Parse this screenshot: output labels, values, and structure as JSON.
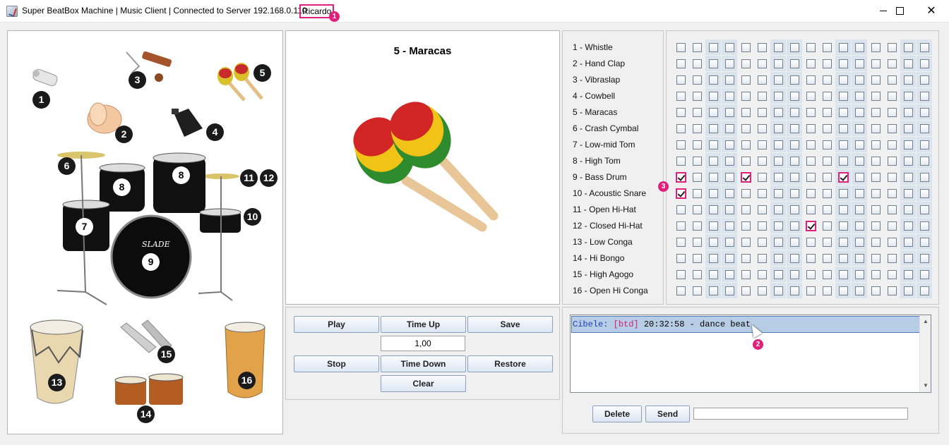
{
  "window": {
    "title": "Super BeatBox Machine | Music Client | Connected to Server 192.168.0.110",
    "user": "Ricardo",
    "controls": {
      "minimize": "",
      "maximize": "",
      "close": "✕"
    }
  },
  "markers": [
    "1",
    "2",
    "3"
  ],
  "instrument_map": {
    "badges": [
      "1",
      "2",
      "3",
      "4",
      "5",
      "6",
      "7",
      "8",
      "8",
      "9",
      "10",
      "11",
      "12",
      "13",
      "14",
      "15",
      "16"
    ],
    "drum_logo": "SLADE"
  },
  "preview": {
    "title": "5 - Maracas"
  },
  "controls": {
    "play": "Play",
    "time_up": "Time Up",
    "save": "Save",
    "tempo": "1,00",
    "stop": "Stop",
    "time_down": "Time Down",
    "restore": "Restore",
    "clear": "Clear"
  },
  "instruments": [
    "1 - Whistle",
    "2 - Hand Clap",
    "3 - Vibraslap",
    "4 - Cowbell",
    "5 - Maracas",
    "6 - Crash Cymbal",
    "7 - Low-mid Tom",
    "8 - High Tom",
    "9 - Bass Drum",
    "10 - Acoustic Snare",
    "11 - Open Hi-Hat",
    "12 - Closed Hi-Hat",
    "13 - Low Conga",
    "14 - Hi Bongo",
    "15 - High Agogo",
    "16 - Open Hi Conga"
  ],
  "grid": {
    "rows": 16,
    "cols": 16,
    "checked": [
      [
        8,
        0
      ],
      [
        8,
        4
      ],
      [
        8,
        10
      ],
      [
        9,
        0
      ],
      [
        11,
        8
      ]
    ]
  },
  "messages": [
    {
      "user": "Cibele:",
      "tag": "[btd]",
      "text": "20:32:58 - dance beat"
    }
  ],
  "chat": {
    "delete": "Delete",
    "send": "Send",
    "input_value": ""
  }
}
